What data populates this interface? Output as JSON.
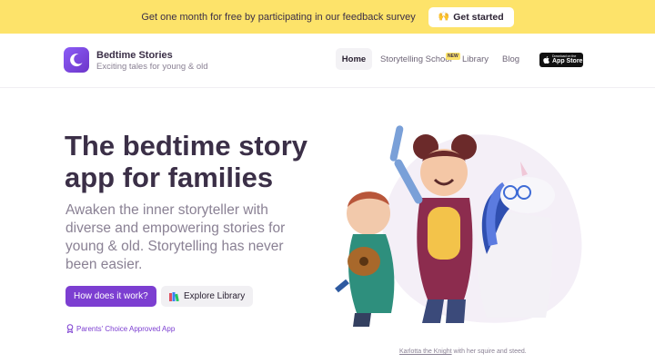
{
  "promo": {
    "text": "Get one month for free by participating in our feedback survey",
    "button_label": "Get started",
    "button_icon": "raised-hands-emoji"
  },
  "brand": {
    "name": "Bedtime Stories",
    "tagline": "Exciting tales for young & old",
    "logo_icon": "crescent-moon-icon",
    "logo_color": "#7c3ed1"
  },
  "nav": {
    "items": [
      {
        "label": "Home",
        "active": true
      },
      {
        "label": "Storytelling School",
        "badge": "NEW"
      },
      {
        "label": "Library"
      },
      {
        "label": "Blog"
      }
    ],
    "appstore": {
      "small": "Download on the",
      "big": "App Store"
    }
  },
  "hero": {
    "title": "The bedtime story app for families",
    "subtitle": "Awaken the inner storyteller with diverse and empowering stories for young & old. Storytelling has never been easier.",
    "primary_cta": "How does it work?",
    "secondary_cta": "Explore Library",
    "secondary_icon": "books-emoji",
    "badge": "Parents' Choice Approved App",
    "badge_icon": "award-ribbon-icon"
  },
  "caption": {
    "link": "Karlotta the Knight",
    "text": " with her squire and steed."
  },
  "colors": {
    "accent": "#7c3ed1",
    "banner": "#fde36a",
    "heading": "#3b2f47",
    "muted": "#8a8194"
  }
}
